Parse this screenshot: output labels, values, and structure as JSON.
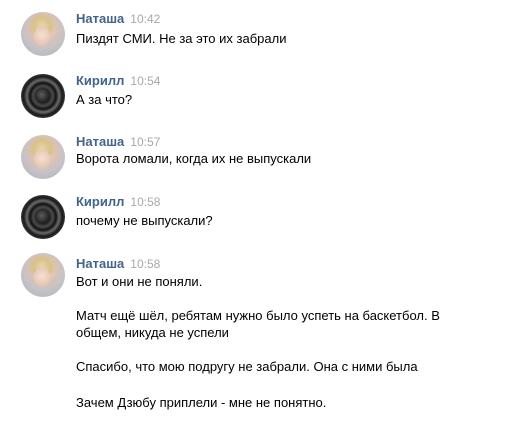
{
  "messages": [
    {
      "author": "Наташа",
      "time": "10:42",
      "avatar_icon": "woman-portrait-avatar",
      "lines": [
        "Пиздят СМИ. Не за это их забрали"
      ]
    },
    {
      "author": "Кирилл",
      "time": "10:54",
      "avatar_icon": "camera-lens-avatar",
      "lines": [
        "А за что?"
      ]
    },
    {
      "author": "Наташа",
      "time": "10:57",
      "avatar_icon": "woman-portrait-avatar",
      "lines": [
        "Ворота ломали, когда их не выпускали"
      ]
    },
    {
      "author": "Кирилл",
      "time": "10:58",
      "avatar_icon": "camera-lens-avatar",
      "lines": [
        "почему не выпускали?"
      ]
    },
    {
      "author": "Наташа",
      "time": "10:58",
      "avatar_icon": "woman-portrait-avatar",
      "lines": [
        "Вот и они не поняли.",
        "Матч ещё шёл, ребятам нужно было успеть на баскетбол. В общем, никуда не успели",
        "Спасибо, что мою подругу не забрали. Она с ними была",
        "Зачем Дзюбу приплели - мне не понятно."
      ]
    }
  ],
  "colors": {
    "author": "#42648b",
    "time": "#a8a8a8",
    "text": "#000000",
    "background": "#ffffff"
  }
}
